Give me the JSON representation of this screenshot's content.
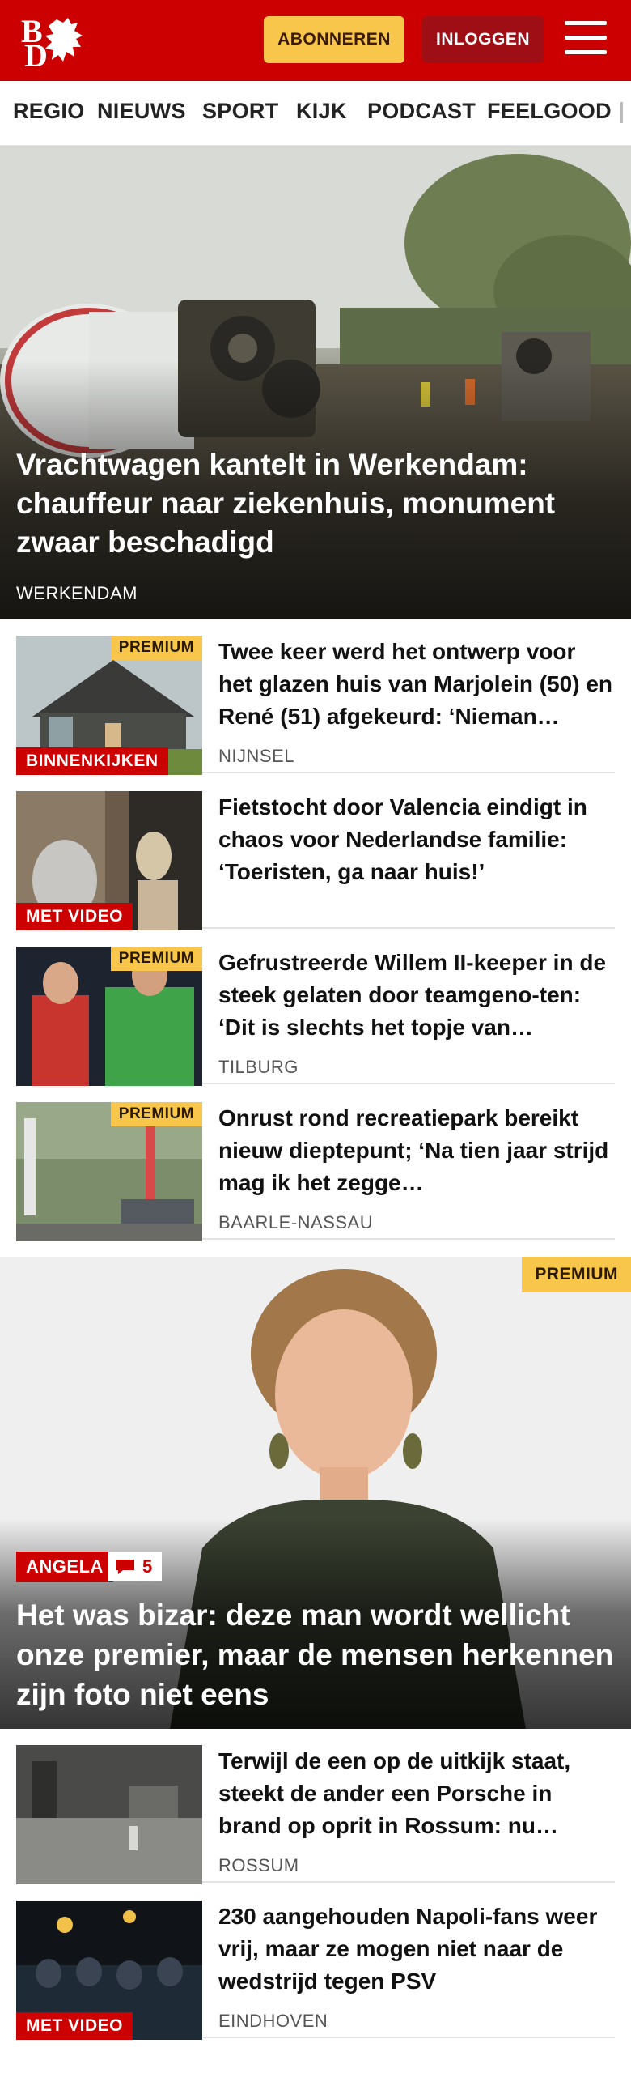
{
  "header": {
    "logo_letters": [
      "B",
      "D"
    ],
    "subscribe_label": "ABONNEREN",
    "login_label": "INLOGGEN"
  },
  "nav": {
    "items": [
      "REGIO",
      "NIEUWS",
      "SPORT",
      "KIJK",
      "PODCAST",
      "FEELGOOD"
    ]
  },
  "hero": {
    "title": "Vrachtwagen kantelt in Werkendam: chauffeur naar ziekenhuis, monument zwaar beschadigd",
    "location": "WERKENDAM"
  },
  "articles": [
    {
      "title": "Twee keer werd het ontwerp voor het glazen huis van Marjolein (50) en René (51) afgekeurd: ‘Nieman…",
      "location": "NIJNSEL",
      "premium": "PREMIUM",
      "tag": "BINNENKIJKEN"
    },
    {
      "title": "Fietstocht door Valencia eindigt in chaos voor Nederlandse familie: ‘Toeristen, ga naar huis!’",
      "location": "",
      "premium": "",
      "tag": "MET VIDEO"
    },
    {
      "title": "Gefrustreerde Willem II-keeper in de steek gelaten door teamgeno-ten: ‘Dit is slechts het topje van…",
      "location": "TILBURG",
      "premium": "PREMIUM",
      "tag": ""
    },
    {
      "title": "Onrust rond recreatiepark bereikt nieuw dieptepunt; ‘Na tien jaar strijd mag ik het zegge…",
      "location": "BAARLE-NASSAU",
      "premium": "PREMIUM",
      "tag": ""
    }
  ],
  "feature": {
    "premium": "PREMIUM",
    "tag": "ANGELA",
    "comments": "5",
    "title": "Het was bizar: deze man wordt wellicht onze premier, maar de mensen herkennen zijn foto niet eens"
  },
  "articles2": [
    {
      "title": "Terwijl de een op de uitkijk staat, steekt de ander een Porsche in brand op oprit in Rossum: nu…",
      "location": "ROSSUM",
      "tag": ""
    },
    {
      "title": "230 aangehouden Napoli-fans weer vrij, maar ze mogen niet naar de wedstrijd tegen PSV",
      "location": "EINDHOVEN",
      "tag": "MET VIDEO"
    }
  ],
  "colors": {
    "brand_red": "#cc0000",
    "premium_yellow": "#f7c64a",
    "login_dark_red": "#9f0e14"
  }
}
